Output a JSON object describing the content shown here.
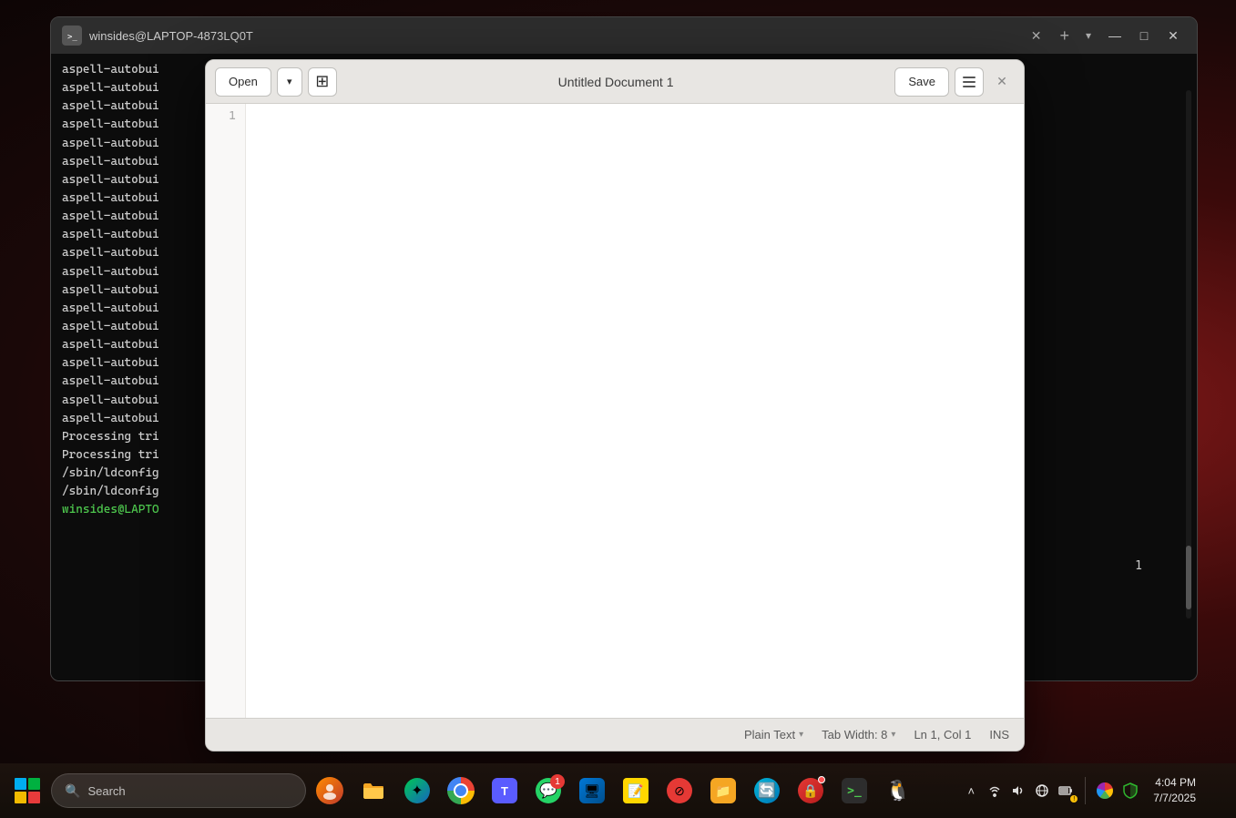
{
  "desktop": {
    "bg_color": "#1a0808"
  },
  "terminal": {
    "title": "winsides@LAPTOP-4873LQ0T",
    "tab_label": "winsides@LAPTOP-4873LQ0T",
    "lines": [
      "aspell-autobui",
      "aspell-autobui",
      "aspell-autobui",
      "aspell-autobui",
      "aspell-autobui",
      "aspell-autobui",
      "aspell-autobui",
      "aspell-autobui",
      "aspell-autobui",
      "aspell-autobui",
      "aspell-autobui",
      "aspell-autobui",
      "aspell-autobui",
      "aspell-autobui",
      "aspell-autobui",
      "aspell-autobui",
      "aspell-autobui",
      "aspell-autobui",
      "aspell-autobui",
      "aspell-autobui",
      "Processing tri",
      "Processing tri",
      "/sbin/ldconfig",
      "/sbin/ldconfig"
    ],
    "prompt_line": "winsides@LAPTO",
    "right_line_number": "1"
  },
  "gedit": {
    "title": "Untitled Document 1",
    "open_label": "Open",
    "save_label": "Save",
    "close_label": "×",
    "line_number": "1",
    "status": {
      "plain_text": "Plain Text",
      "tab_width": "Tab Width: 8",
      "cursor_pos": "Ln 1, Col 1",
      "ins": "INS"
    }
  },
  "taskbar": {
    "search_placeholder": "Search",
    "search_icon": "🔍",
    "apps": [
      {
        "name": "file-explorer",
        "label": "File Explorer"
      },
      {
        "name": "feather",
        "label": "Feather/Copilot"
      },
      {
        "name": "avatar",
        "label": "Avatar"
      },
      {
        "name": "teams",
        "label": "Microsoft Teams"
      },
      {
        "name": "chrome",
        "label": "Google Chrome",
        "badge": ""
      },
      {
        "name": "whatsapp",
        "label": "WhatsApp",
        "badge": "1"
      },
      {
        "name": "rdp",
        "label": "Remote Desktop"
      },
      {
        "name": "sticky-notes",
        "label": "Sticky Notes"
      },
      {
        "name": "todo",
        "label": "To Do"
      },
      {
        "name": "files",
        "label": "Files"
      },
      {
        "name": "edge-refresh",
        "label": "Edge Refresh"
      },
      {
        "name": "security",
        "label": "Security"
      },
      {
        "name": "terminal",
        "label": "Terminal"
      },
      {
        "name": "linux",
        "label": "Linux/Penguin"
      }
    ],
    "tray": {
      "up_arrow": "˄",
      "network": "WiFi",
      "volume": "🔊",
      "battery": "🔋"
    }
  }
}
